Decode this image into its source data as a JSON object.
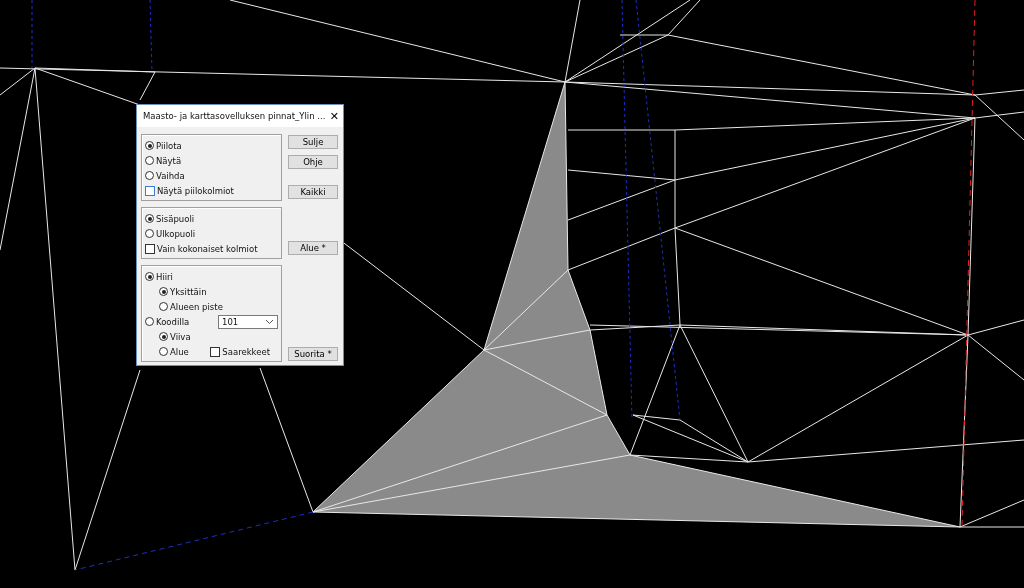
{
  "dialog": {
    "title": "Maasto- ja karttasovelluksen pinnat_Ylin ...",
    "close": "✕",
    "visibility": [
      {
        "kind": "radio",
        "label": "Piilota",
        "selected": true
      },
      {
        "kind": "radio",
        "label": "Näytä",
        "selected": false
      },
      {
        "kind": "radio",
        "label": "Vaihda",
        "selected": false
      },
      {
        "kind": "checkbox",
        "label": "Näytä piilokolmiot",
        "checked": false
      }
    ],
    "scope": [
      {
        "kind": "radio",
        "label": "Sisäpuoli",
        "selected": true
      },
      {
        "kind": "radio",
        "label": "Ulkopuoli",
        "selected": false
      },
      {
        "kind": "checkbox",
        "label": "Vain kokonaiset kolmiot",
        "checked": false
      }
    ],
    "selection": [
      {
        "label": "Hiiri",
        "selected": true,
        "children": [
          {
            "label": "Yksittäin",
            "selected": true
          },
          {
            "label": "Alueen piste",
            "selected": false
          }
        ]
      },
      {
        "label": "Koodilla",
        "selected": false,
        "dropdown": "101",
        "children": [
          {
            "label": "Viiva",
            "selected": true
          },
          {
            "label": "Alue",
            "selected": false
          }
        ]
      }
    ],
    "islands": {
      "label": "Saarekkeet",
      "checked": false
    },
    "buttons": [
      "Sulje",
      "Ohje",
      "Kaikki",
      "Alue *",
      "Suorita *"
    ]
  }
}
